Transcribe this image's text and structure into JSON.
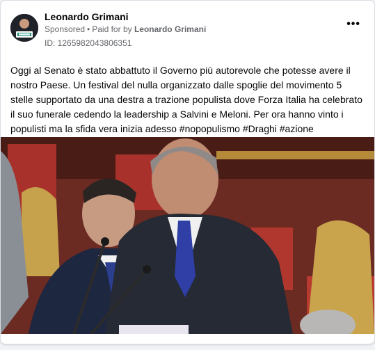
{
  "post": {
    "author": "Leonardo Grimani",
    "sponsored_label": "Sponsored",
    "separator": "•",
    "paid_for_label": "Paid for by",
    "paid_for_name": "Leonardo Grimani",
    "ad_id": "ID: 1265982043806351",
    "more_label": "•••",
    "text": "Oggi al Senato è stato abbattuto il Governo più autorevole che potesse avere il nostro Paese. Un festival del nulla organizzato dalle spoglie del movimento 5 stelle supportato da una destra a trazione populista dove Forza Italia ha celebrato il suo funerale cedendo la leadership a Salvini e Meloni. Per ora hanno vinto i populisti ma la sfida vera inizia adesso #nopopulismo #Draghi #azione"
  },
  "colors": {
    "text_primary": "#050505",
    "text_secondary": "#65676b",
    "card_bg": "#ffffff",
    "page_bg": "#f0f2f5"
  },
  "icons": {
    "more": "more-horizontal-icon",
    "avatar": "profile-avatar"
  }
}
